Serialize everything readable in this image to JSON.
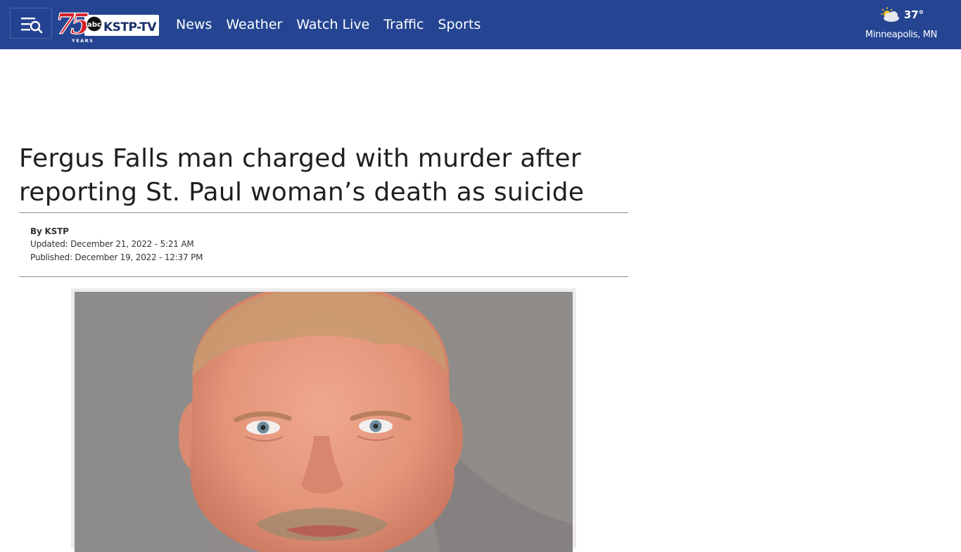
{
  "header": {
    "menu_icon": "menu-search-icon",
    "logo": {
      "anniversary_number": "75",
      "network_badge": "abc",
      "station_name": "KSTP-TV",
      "years_label": "YEARS"
    },
    "nav_items": [
      {
        "label": "News"
      },
      {
        "label": "Weather"
      },
      {
        "label": "Watch Live"
      },
      {
        "label": "Traffic"
      },
      {
        "label": "Sports"
      }
    ],
    "weather": {
      "icon": "partly-cloudy-icon",
      "temperature": "37°",
      "location": "Minneapolis, MN"
    }
  },
  "article": {
    "headline": "Fergus Falls man charged with murder after reporting St. Paul woman’s death as suicide",
    "byline": "By KSTP",
    "updated": "Updated: December 21, 2022 - 5:21 AM",
    "published": "Published: December 19, 2022 - 12:37 PM"
  },
  "colors": {
    "header_bg": "#254592",
    "logo_red": "#d4202a",
    "text": "#1f1f1f"
  }
}
